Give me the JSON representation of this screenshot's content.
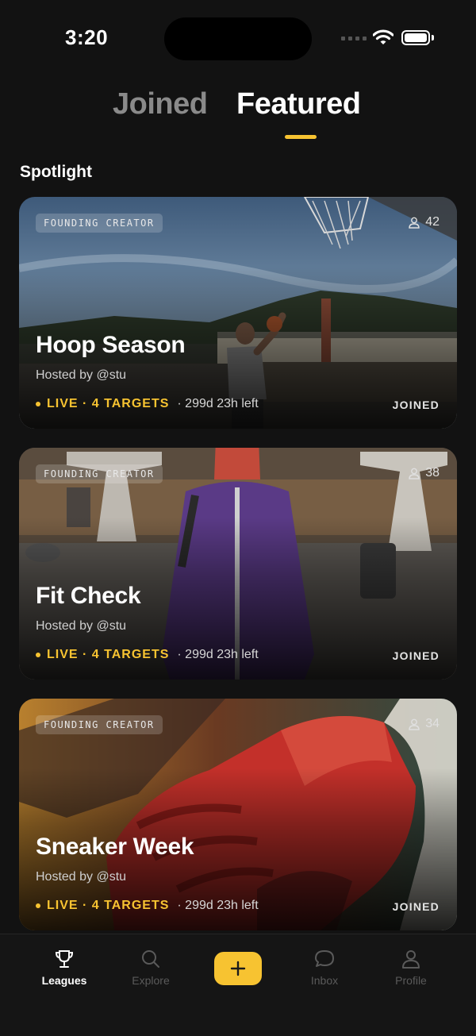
{
  "status": {
    "time": "3:20"
  },
  "tabs": {
    "joined": "Joined",
    "featured": "Featured"
  },
  "section": {
    "title": "Spotlight"
  },
  "colors": {
    "accent": "#F7C331",
    "background": "#121212"
  },
  "cards": [
    {
      "badge": "FOUNDING CREATOR",
      "members": "42",
      "title": "Hoop Season",
      "host": "Hosted by @stu",
      "status": "LIVE · 4 TARGETS",
      "time_left": "· 299d 23h left",
      "joined": "JOINED"
    },
    {
      "badge": "FOUNDING CREATOR",
      "members": "38",
      "title": "Fit Check",
      "host": "Hosted by @stu",
      "status": "LIVE · 4 TARGETS",
      "time_left": "· 299d 23h left",
      "joined": "JOINED"
    },
    {
      "badge": "FOUNDING CREATOR",
      "members": "34",
      "title": "Sneaker Week",
      "host": "Hosted by @stu",
      "status": "LIVE · 4 TARGETS",
      "time_left": "· 299d 23h left",
      "joined": "JOINED"
    }
  ],
  "nav": {
    "leagues": "Leagues",
    "explore": "Explore",
    "create_icon": "plus-icon",
    "inbox": "Inbox",
    "profile": "Profile"
  }
}
